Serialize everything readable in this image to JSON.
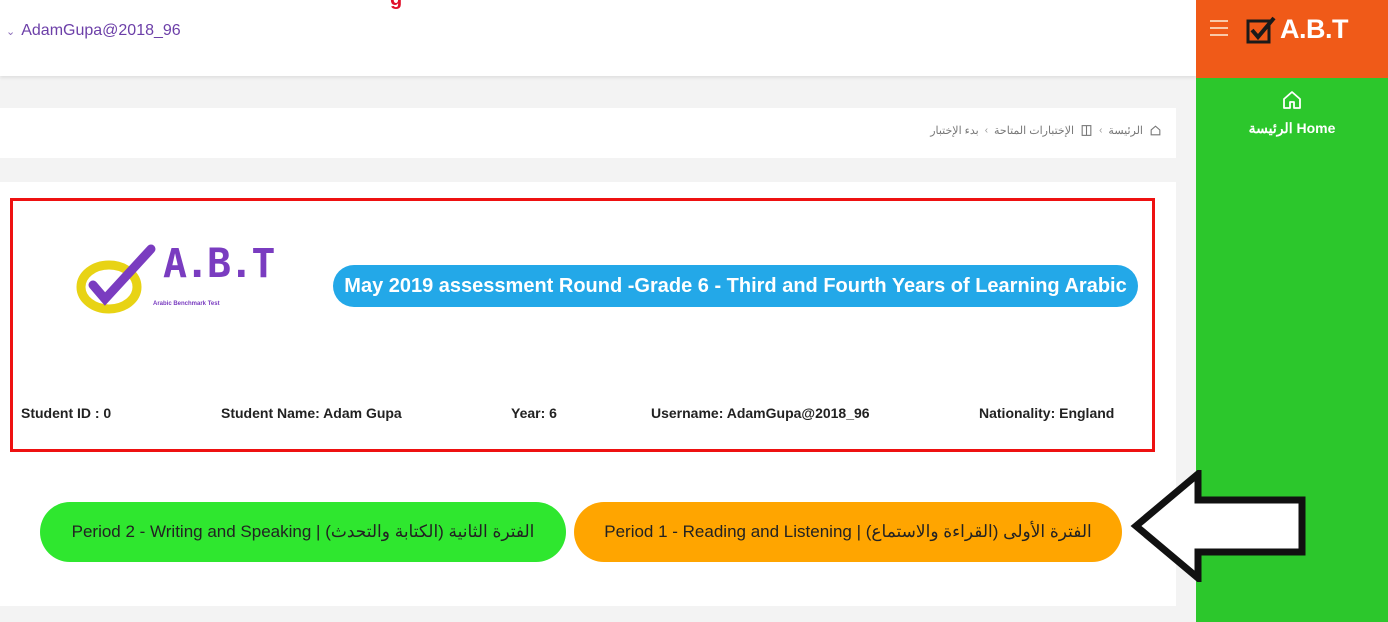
{
  "header": {
    "top_title": "g",
    "username": "AdamGupa@2018_96"
  },
  "sidebar": {
    "brand": "A.B.T",
    "home_label": "الرئيسة Home"
  },
  "breadcrumb": {
    "items": [
      "الرئيسة",
      "الإختبارات المتاحة",
      "بدء الإختبار"
    ]
  },
  "assessment": {
    "logo_text": "A.B.T",
    "logo_subtitle": "Arabic Benchmark Test",
    "title": "May 2019 assessment Round -Grade 6 - Third and Fourth Years of Learning Arabic",
    "student_id": "Student ID : 0",
    "student_name": "Student Name: Adam Gupa",
    "year": "Year: 6",
    "username": "Username: AdamGupa@2018_96",
    "nationality": "Nationality: England"
  },
  "periods": {
    "period_1": "Period 1 - Reading and Listening | الفترة الأولى (القراءة والاستماع)",
    "period_2": "Period 2 - Writing and Speaking | الفترة الثانية (الكتابة والتحدث)"
  },
  "colors": {
    "sidebar_green": "#2cc72c",
    "brand_orange": "#f05a18",
    "period_1": "#ffa500",
    "period_2": "#2fe72f",
    "title_pill": "#23a8e8",
    "frame_red": "#ee1111"
  }
}
